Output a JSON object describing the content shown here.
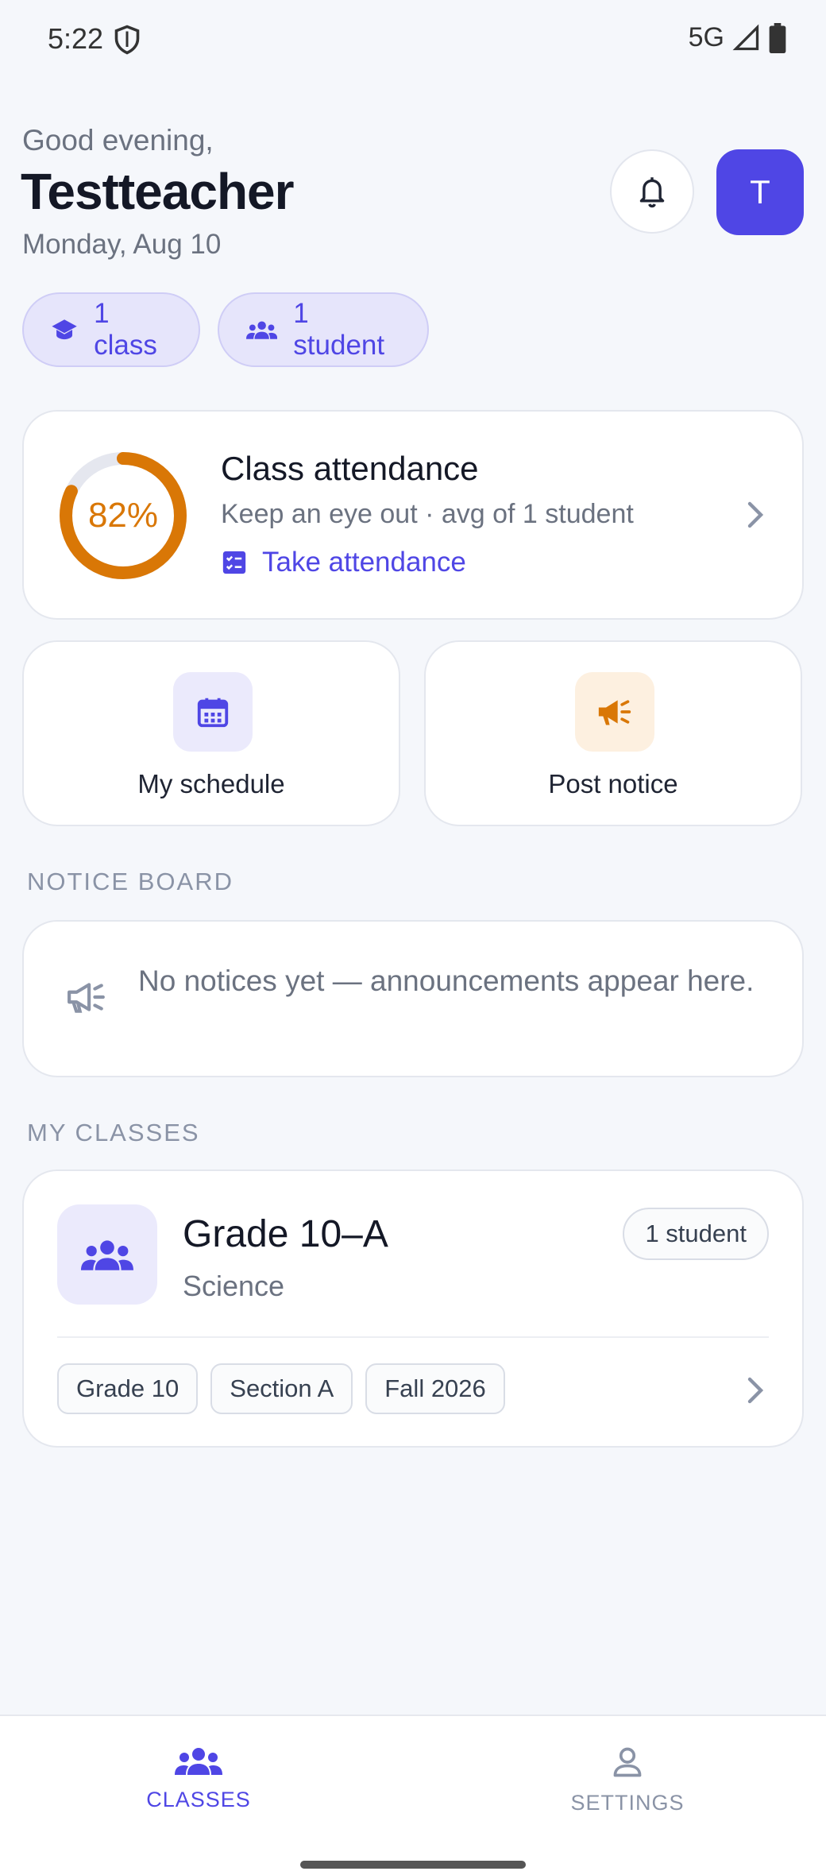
{
  "status_bar": {
    "time": "5:22",
    "network": "5G"
  },
  "header": {
    "greeting": "Good evening,",
    "name": "Testteacher",
    "date": "Monday, Aug 10",
    "avatar_initial": "T"
  },
  "chips": {
    "classes": "1 class",
    "students": "1 student"
  },
  "attendance": {
    "percent_label": "82%",
    "percent": 0.82,
    "title": "Class attendance",
    "subtitle": "Keep an eye out · avg of 1 student",
    "link": "Take attendance"
  },
  "actions": {
    "schedule": "My schedule",
    "post_notice": "Post notice"
  },
  "notice_board": {
    "label": "NOTICE BOARD",
    "empty_text": "No notices yet — announcements appear here."
  },
  "my_classes": {
    "label": "MY CLASSES",
    "items": [
      {
        "name": "Grade 10–A",
        "subject": "Science",
        "students": "1 student",
        "tags": [
          "Grade 10",
          "Section A",
          "Fall 2026"
        ]
      }
    ]
  },
  "bottom_nav": {
    "classes": "CLASSES",
    "settings": "SETTINGS"
  },
  "colors": {
    "accent": "#4f46e5",
    "ring": "#d97706",
    "ring_track": "#e5e7ef"
  }
}
